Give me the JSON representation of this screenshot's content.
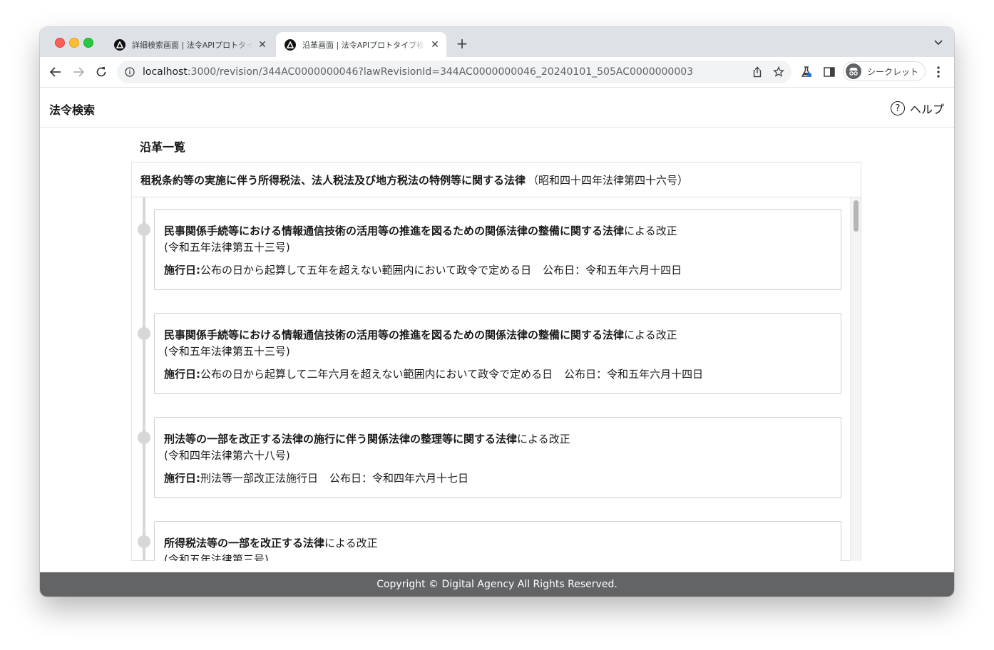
{
  "browser": {
    "tabs": [
      {
        "title": "詳細検索画面 | 法令APIプロトタイプ",
        "active": false
      },
      {
        "title": "沿革画面 | 法令APIプロトタイプ検索",
        "active": true
      }
    ],
    "url_host": "localhost",
    "url_rest": ":3000/revision/344AC0000000046?lawRevisionId=344AC0000000046_20240101_505AC0000000003",
    "profile_label": "シークレット"
  },
  "header": {
    "app_title": "法令検索",
    "help_label": "ヘルプ",
    "help_icon_glyph": "?"
  },
  "main": {
    "section_title": "沿革一覧",
    "law_name": "租税条約等の実施に伴う所得税法、法人税法及び地方税法の特例等に関する法律",
    "law_number": "（昭和四十四年法律第四十六号）",
    "revisions": [
      {
        "name": "民事関係手続等における情報通信技術の活用等の推進を図るための関係法律の整備に関する法律",
        "suffix": "による改正",
        "number": "(令和五年法律第五十三号)",
        "enforcement_label": "施行日:",
        "enforcement": "公布の日から起算して五年を超えない範囲内において政令で定める日",
        "promulgation": "公布日：令和五年六月十四日"
      },
      {
        "name": "民事関係手続等における情報通信技術の活用等の推進を図るための関係法律の整備に関する法律",
        "suffix": "による改正",
        "number": "(令和五年法律第五十三号)",
        "enforcement_label": "施行日:",
        "enforcement": "公布の日から起算して二年六月を超えない範囲内において政令で定める日",
        "promulgation": "公布日：令和五年六月十四日"
      },
      {
        "name": "刑法等の一部を改正する法律の施行に伴う関係法律の整理等に関する法律",
        "suffix": "による改正",
        "number": "(令和四年法律第六十八号)",
        "enforcement_label": "施行日:",
        "enforcement": "刑法等一部改正法施行日",
        "promulgation": "公布日：令和四年六月十七日"
      },
      {
        "name": "所得税法等の一部を改正する法律",
        "suffix": "による改正",
        "number": "(令和五年法律第三号)",
        "enforcement_label": "",
        "enforcement": "",
        "promulgation": ""
      }
    ]
  },
  "footer": {
    "copyright": "Copyright © Digital Agency All Rights Reserved."
  },
  "colors": {
    "footer_bg": "#636466",
    "timeline": "#d7d7d7",
    "card_border": "#cfcfcf"
  }
}
